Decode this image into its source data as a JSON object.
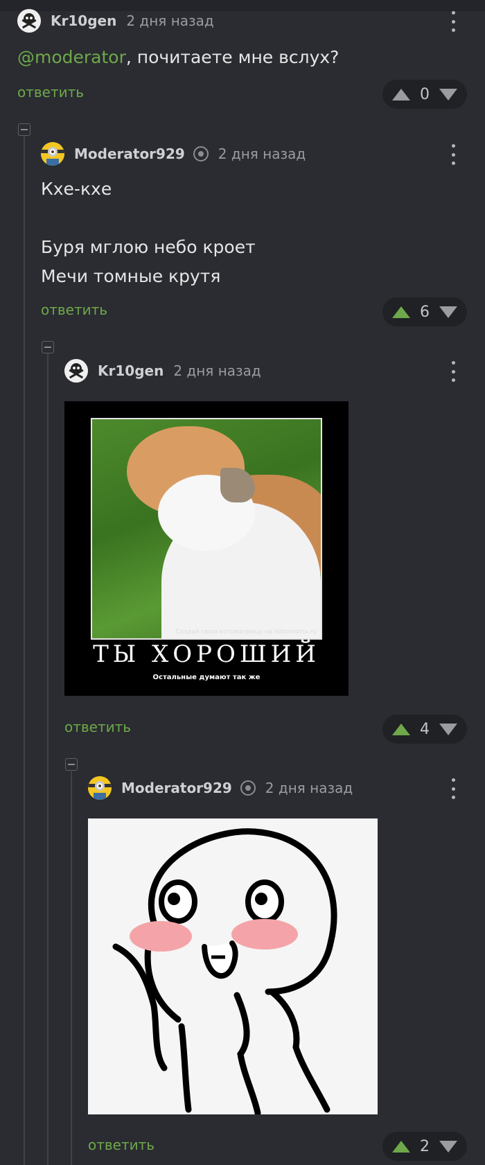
{
  "comments": [
    {
      "username": "Kr10gen",
      "time": "2 дня назад",
      "text": {
        "mention": "@moderator",
        "rest": ", почитаете мне вслух?"
      },
      "reply": "ответить",
      "votes": "0",
      "upvoted": false
    },
    {
      "username": "Moderator929",
      "time": "2 дня назад",
      "lines": [
        "Кхе-кхе",
        "",
        "Буря мглою небо кроет",
        "Мечи томные крутя"
      ],
      "reply": "ответить",
      "votes": "6",
      "upvoted": true
    },
    {
      "username": "Kr10gen",
      "time": "2 дня назад",
      "image": {
        "title": "ТЫ ХОРОШИЙ",
        "subtitle": "Остальные думают так же",
        "watermark": "Создай свою котоматрицу на kotomatrix.ru"
      },
      "reply": "ответить",
      "votes": "4",
      "upvoted": true
    },
    {
      "username": "Moderator929",
      "time": "2 дня назад",
      "reply": "ответить",
      "votes": "2",
      "upvoted": true
    }
  ],
  "colors": {
    "accent": "#6ea84a",
    "background": "#2a2c31"
  }
}
